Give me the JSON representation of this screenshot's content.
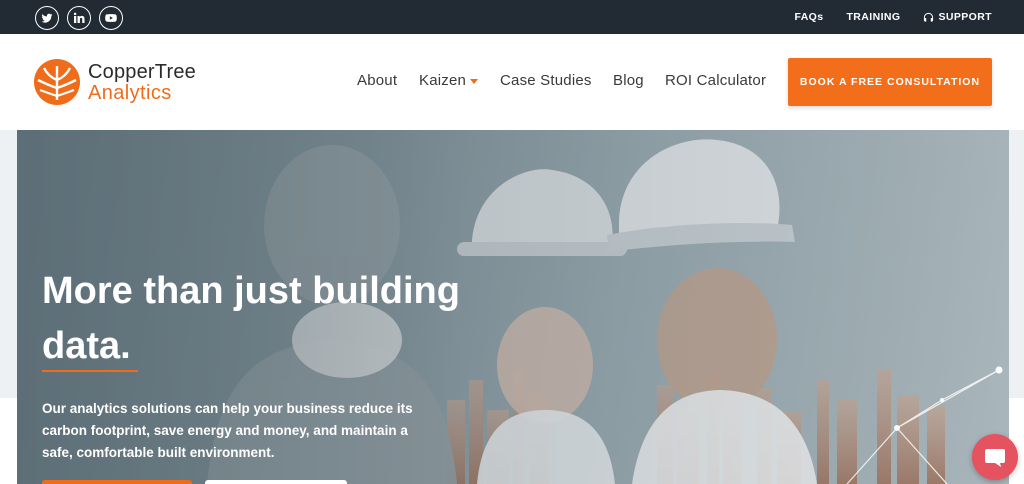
{
  "topbar": {
    "social": [
      {
        "name": "twitter-icon"
      },
      {
        "name": "linkedin-icon"
      },
      {
        "name": "youtube-icon"
      }
    ],
    "links": [
      {
        "label": "FAQs"
      },
      {
        "label": "TRAINING"
      },
      {
        "label": "SUPPORT"
      }
    ]
  },
  "header": {
    "logo_line1": "CopperTree",
    "logo_line2": "Analytics",
    "nav": [
      {
        "label": "About"
      },
      {
        "label": "Kaizen"
      },
      {
        "label": "Case Studies"
      },
      {
        "label": "Blog"
      },
      {
        "label": "ROI Calculator"
      }
    ],
    "cta_label": "BOOK A FREE CONSULTATION"
  },
  "hero": {
    "title": "More than just building data.",
    "subtitle": "Our analytics solutions can help your business reduce its carbon footprint, save energy and money, and maintain a safe, comfortable built environment."
  },
  "colors": {
    "accent": "#ef6c1a",
    "topbar_bg": "#222b33",
    "chat_bg": "#e55260"
  },
  "icons": {
    "chat": "chat-bubble-icon",
    "support": "headset-icon"
  }
}
